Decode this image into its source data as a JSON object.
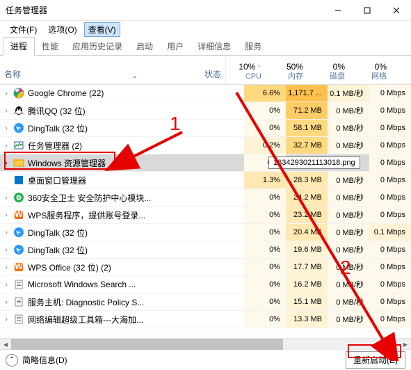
{
  "window": {
    "title": "任务管理器"
  },
  "menu": {
    "file": "文件(F)",
    "options": "选项(O)",
    "view": "查看(V)"
  },
  "tabs": {
    "processes": "进程",
    "performance": "性能",
    "app_history": "应用历史记录",
    "startup": "启动",
    "users": "用户",
    "details": "详细信息",
    "services": "服务"
  },
  "columns": {
    "name": "名称",
    "status": "状态",
    "cpu": {
      "pct": "10%",
      "label": "CPU"
    },
    "memory": {
      "pct": "50%",
      "label": "内存"
    },
    "disk": {
      "pct": "0%",
      "label": "磁盘"
    },
    "network": {
      "pct": "0%",
      "label": "网络"
    }
  },
  "rows": [
    {
      "name": "Google Chrome (22)",
      "cpu": "6.6%",
      "mem": "1,171.7 ...",
      "disk": "0.1 MB/秒",
      "net": "0 Mbps",
      "icon": "chrome",
      "expandable": true
    },
    {
      "name": "腾讯QQ (32 位)",
      "cpu": "0%",
      "mem": "71.2 MB",
      "disk": "0 MB/秒",
      "net": "0 Mbps",
      "icon": "qq",
      "expandable": true
    },
    {
      "name": "DingTalk (32 位)",
      "cpu": "0%",
      "mem": "58.1 MB",
      "disk": "0 MB/秒",
      "net": "0 Mbps",
      "icon": "dingtalk",
      "expandable": true
    },
    {
      "name": "任务管理器 (2)",
      "cpu": "0.2%",
      "mem": "32.7 MB",
      "disk": "0 MB/秒",
      "net": "0 Mbps",
      "icon": "taskmgr",
      "expandable": true
    },
    {
      "name": "Windows 资源管理器",
      "cpu": "0....",
      "mem": "",
      "disk": "",
      "net": "0 Mbps",
      "icon": "explorer",
      "expandable": true,
      "selected": true
    },
    {
      "name": "桌面窗口管理器",
      "cpu": "1.3%",
      "mem": "28.3 MB",
      "disk": "0 MB/秒",
      "net": "0 Mbps",
      "icon": "dwm",
      "expandable": false
    },
    {
      "name": "360安全卫士 安全防护中心模块...",
      "cpu": "0%",
      "mem": "24.2 MB",
      "disk": "0 MB/秒",
      "net": "0 Mbps",
      "icon": "360",
      "expandable": true
    },
    {
      "name": "WPS服务程序，提供账号登录...",
      "cpu": "0%",
      "mem": "23.2 MB",
      "disk": "0 MB/秒",
      "net": "0 Mbps",
      "icon": "wps",
      "expandable": true
    },
    {
      "name": "DingTalk (32 位)",
      "cpu": "0%",
      "mem": "20.4 MB",
      "disk": "0 MB/秒",
      "net": "0.1 Mbps",
      "icon": "dingtalk",
      "expandable": true
    },
    {
      "name": "DingTalk (32 位)",
      "cpu": "0%",
      "mem": "19.6 MB",
      "disk": "0 MB/秒",
      "net": "0 Mbps",
      "icon": "dingtalk",
      "expandable": true
    },
    {
      "name": "WPS Office (32 位) (2)",
      "cpu": "0%",
      "mem": "17.7 MB",
      "disk": "0 MB/秒",
      "net": "0 Mbps",
      "icon": "wps",
      "expandable": true
    },
    {
      "name": "Microsoft Windows Search ...",
      "cpu": "0%",
      "mem": "16.2 MB",
      "disk": "0 MB/秒",
      "net": "0 Mbps",
      "icon": "generic",
      "expandable": true
    },
    {
      "name": "服务主机: Diagnostic Policy S...",
      "cpu": "0%",
      "mem": "15.1 MB",
      "disk": "0 MB/秒",
      "net": "0 Mbps",
      "icon": "generic",
      "expandable": true
    },
    {
      "name": "网络编辑超级工具箱---大海加...",
      "cpu": "0%",
      "mem": "13.3 MB",
      "disk": "0 MB/秒",
      "net": "0 Mbps",
      "icon": "generic",
      "expandable": true
    }
  ],
  "tooltip": "1634293021113018.png",
  "footer": {
    "brief": "简略信息(D)",
    "restart": "重新启动(E)"
  },
  "annotations": {
    "num1": "1",
    "num2": "2"
  }
}
